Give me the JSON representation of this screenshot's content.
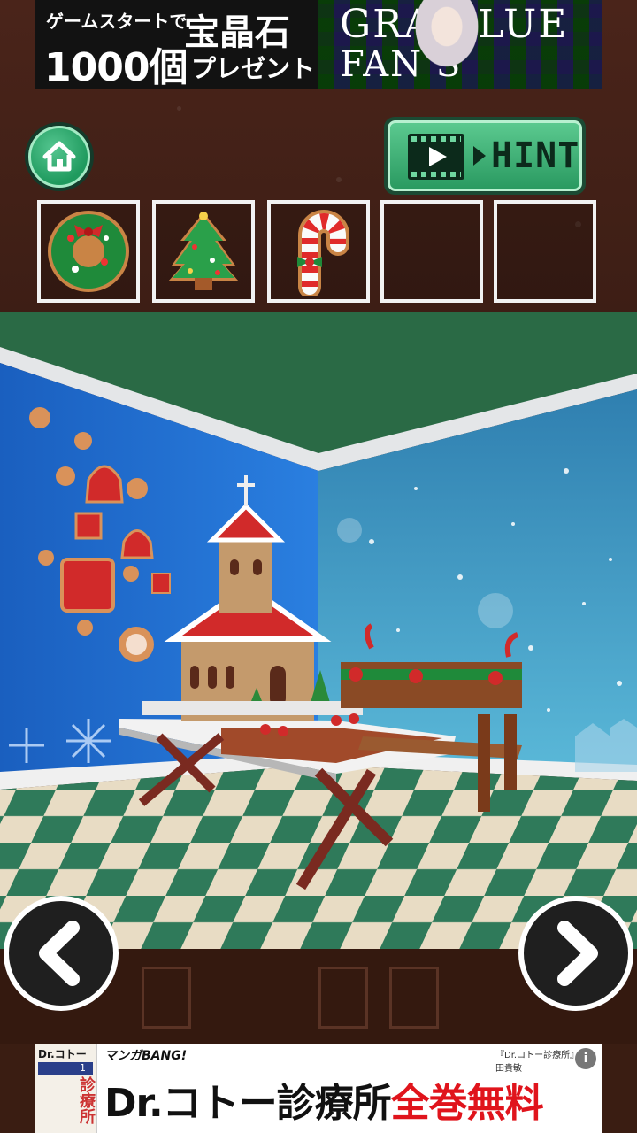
{
  "ad_top": {
    "line1": "ゲームスタートで",
    "line2": "1000個",
    "line3": "宝晶石",
    "line4": "プレゼント",
    "right_line1": "GRA  BLUE",
    "right_line2": "FAN   S"
  },
  "toolbar": {
    "home_icon": "house-icon",
    "hint_label": "HINT",
    "hint_icon": "film-play-icon"
  },
  "inventory": {
    "slots": [
      {
        "item": "wreath-cookie"
      },
      {
        "item": "christmas-tree-cookie"
      },
      {
        "item": "candy-cane-cookie"
      },
      {
        "item": ""
      },
      {
        "item": ""
      }
    ]
  },
  "nav": {
    "left_icon": "chevron-left-icon",
    "right_icon": "chevron-right-icon"
  },
  "ad_bottom": {
    "cover_title": "Dr.コトー",
    "cover_volume": "1",
    "cover_kanji": "診療所",
    "brand": "マンガBANG!",
    "copyright": "『Dr.コトー診療所』©山田貴敏",
    "info_icon": "i",
    "title_black": "Dr.コトー診療所",
    "title_red": "全巻無料"
  },
  "colors": {
    "brown_bg": "#3d1e15",
    "button_green": "#2a9a61",
    "wall_left": "#1f6fd1",
    "wall_right": "#2f8fb8",
    "ceiling": "#2a6a45",
    "floor_green": "#2f7a5a",
    "floor_cream": "#e8dcc4",
    "ad_red": "#e0141c"
  }
}
